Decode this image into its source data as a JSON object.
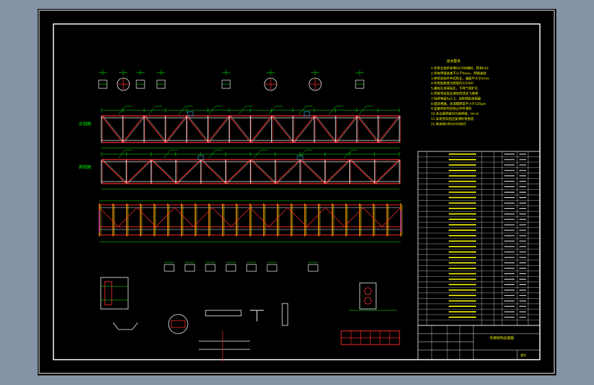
{
  "drawing": {
    "colors": {
      "background": "#000000",
      "frame": "#ffffff",
      "truss_red": "#ff2a2a",
      "dimension_green": "#00ff00",
      "note_yellow": "#ffff00",
      "member_orange": "#ff9900",
      "accent_magenta": "#ff33ff",
      "accent_cyan": "#33ccff"
    },
    "notes_title": "技术要求",
    "notes_lines": [
      "1.桁架主弦杆采用Q235B钢材，焊条E43",
      "2.所有焊缝高度不小于6mm，焊缝连续",
      "3.拼装前各杆件应校正，偏差不大于2mm",
      "4.桁架起拱值为跨度的1/1000",
      "5.螺栓孔采用钻孔，不得气割扩孔",
      "6.焊接完成后应清除焊渣及飞溅物",
      "7.除锈等级Sa2.5，涂防锈底漆两遍",
      "8.面漆两遍，总漆膜厚度不小于120μm",
      "9.运输吊装时应防止杆件变形",
      "10.未注明焊缝均为角焊缝，hf=6",
      "11.安装完毕后应复测桁架挠度",
      "12.其余按GB50205执行"
    ],
    "view_labels": [
      "正视图",
      "俯视图"
    ],
    "title_block": {
      "drawing_title": "桁架结构总装图",
      "sheet_label": "图号"
    }
  }
}
